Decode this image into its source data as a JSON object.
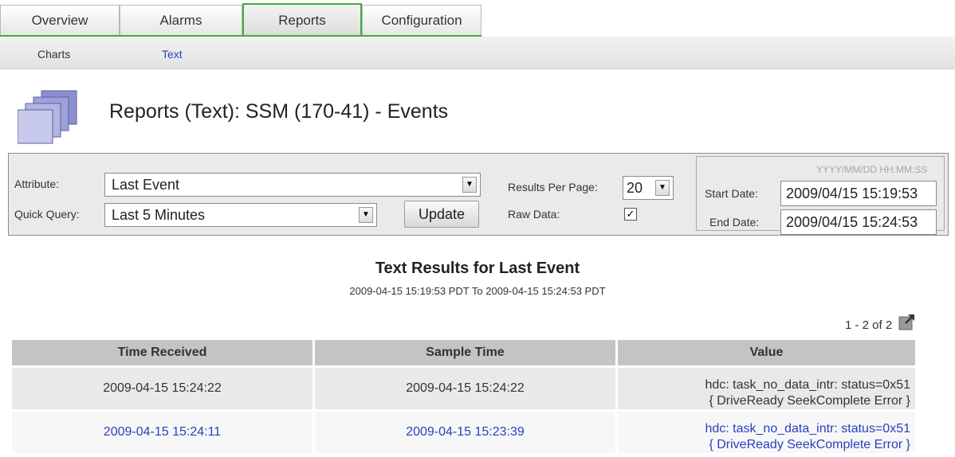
{
  "tabs": [
    {
      "label": "Overview"
    },
    {
      "label": "Alarms"
    },
    {
      "label": "Reports"
    },
    {
      "label": "Configuration"
    }
  ],
  "active_tab": "Reports",
  "subtabs": [
    {
      "label": "Charts"
    },
    {
      "label": "Text"
    }
  ],
  "active_subtab": "Text",
  "page": {
    "title": "Reports (Text): SSM (170-41) - Events",
    "icon": "stacked-pages-icon"
  },
  "query": {
    "attribute_label": "Attribute:",
    "attribute_value": "Last Event",
    "quick_query_label": "Quick Query:",
    "quick_query_value": "Last 5 Minutes",
    "update_label": "Update",
    "results_per_page_label": "Results Per Page:",
    "results_per_page_value": "20",
    "raw_data_label": "Raw Data:",
    "raw_data_checked": "✓",
    "date_format_hint": "YYYY/MM/DD HH:MM:SS",
    "start_date_label": "Start Date:",
    "start_date_value": "2009/04/15 15:19:53",
    "end_date_label": "End Date:",
    "end_date_value": "2009/04/15 15:24:53"
  },
  "results": {
    "title": "Text Results for Last Event",
    "range": "2009-04-15 15:19:53 PDT To 2009-04-15 15:24:53 PDT",
    "pager": "1 - 2 of 2",
    "export_icon": "export-icon"
  },
  "table": {
    "columns": [
      "Time Received",
      "Sample Time",
      "Value"
    ],
    "rows": [
      {
        "time_received": "2009-04-15 15:24:22",
        "sample_time": "2009-04-15 15:24:22",
        "value_line1": "hdc: task_no_data_intr: status=0x51",
        "value_line2": "{ DriveReady SeekComplete Error }"
      },
      {
        "time_received": "2009-04-15 15:24:11",
        "sample_time": "2009-04-15 15:23:39",
        "value_line1": "hdc: task_no_data_intr: status=0x51",
        "value_line2": "{ DriveReady SeekComplete Error }"
      }
    ]
  },
  "colors": {
    "active_tab_border": "#3fae3a",
    "link_blue": "#2a3fc0",
    "header_gray": "#c4c4c4"
  }
}
